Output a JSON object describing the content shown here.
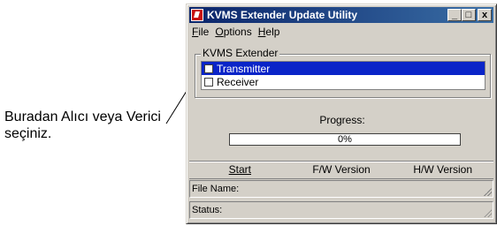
{
  "annotation": {
    "line1": "Buradan Alıcı veya Verici",
    "line2": "seçiniz."
  },
  "window": {
    "title": "KVMS Extender Update Utility",
    "buttons": {
      "minimize": "_",
      "maximize": "□",
      "close": "x"
    }
  },
  "menu": [
    {
      "label": "File"
    },
    {
      "label": "Options"
    },
    {
      "label": "Help"
    }
  ],
  "group": {
    "title": "KVMS Extender",
    "items": [
      {
        "label": "Transmitter",
        "checked": false,
        "selected": true
      },
      {
        "label": "Receiver",
        "checked": false,
        "selected": false
      }
    ]
  },
  "progress": {
    "label": "Progress:",
    "value_text": "0%",
    "value": 0
  },
  "actions": {
    "start": "Start",
    "fw_version": "F/W Version",
    "hw_version": "H/W Version"
  },
  "status": {
    "file_name_label": "File Name:",
    "status_label": "Status:"
  },
  "colors": {
    "titlebar": "#0a246a",
    "selection": "#0a24c8",
    "window_bg": "#d4d0c8"
  }
}
